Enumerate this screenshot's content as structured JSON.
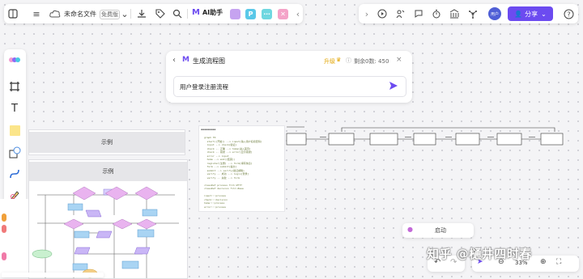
{
  "app": {
    "doc_title": "未命名文件",
    "plan_badge": "免费版",
    "ai_label": "AI助手",
    "share_label": "分享",
    "avatar_label": "用户"
  },
  "ai_panel": {
    "title": "生成流程图",
    "upgrade_label": "升级",
    "remaining_label": "剩余0数: 450",
    "input_value": "用户登录注册流程"
  },
  "examples": {
    "example1_title": "示例",
    "example2_title": "示例"
  },
  "hint_bar": {
    "label": "启动"
  },
  "zoom": {
    "level": "33%"
  },
  "watermark": "知乎 @樋井四时春",
  "code_text": "graph TD\n  start([开始]) --> input[输入用户名和密码]\n  input --> check{验证}\n  check -- 正确 --> home[进入首页]\n  check -- 错误 --> error[显示错误]\n  error --> input\n  home --> end([结束])\n  register[注册] --> form[填写信息]\n  form --> submit[提交]\n  submit --> verify{验证邮箱}\n  verify -- 成功 --> login[登录]\n  verify -- 失败 --> form\n\nclassDef process fill:#fff\nclassDef decision fill:#eee\n\ninput:::process\ncheck:::decision\nhome:::process\nerror:::process"
}
